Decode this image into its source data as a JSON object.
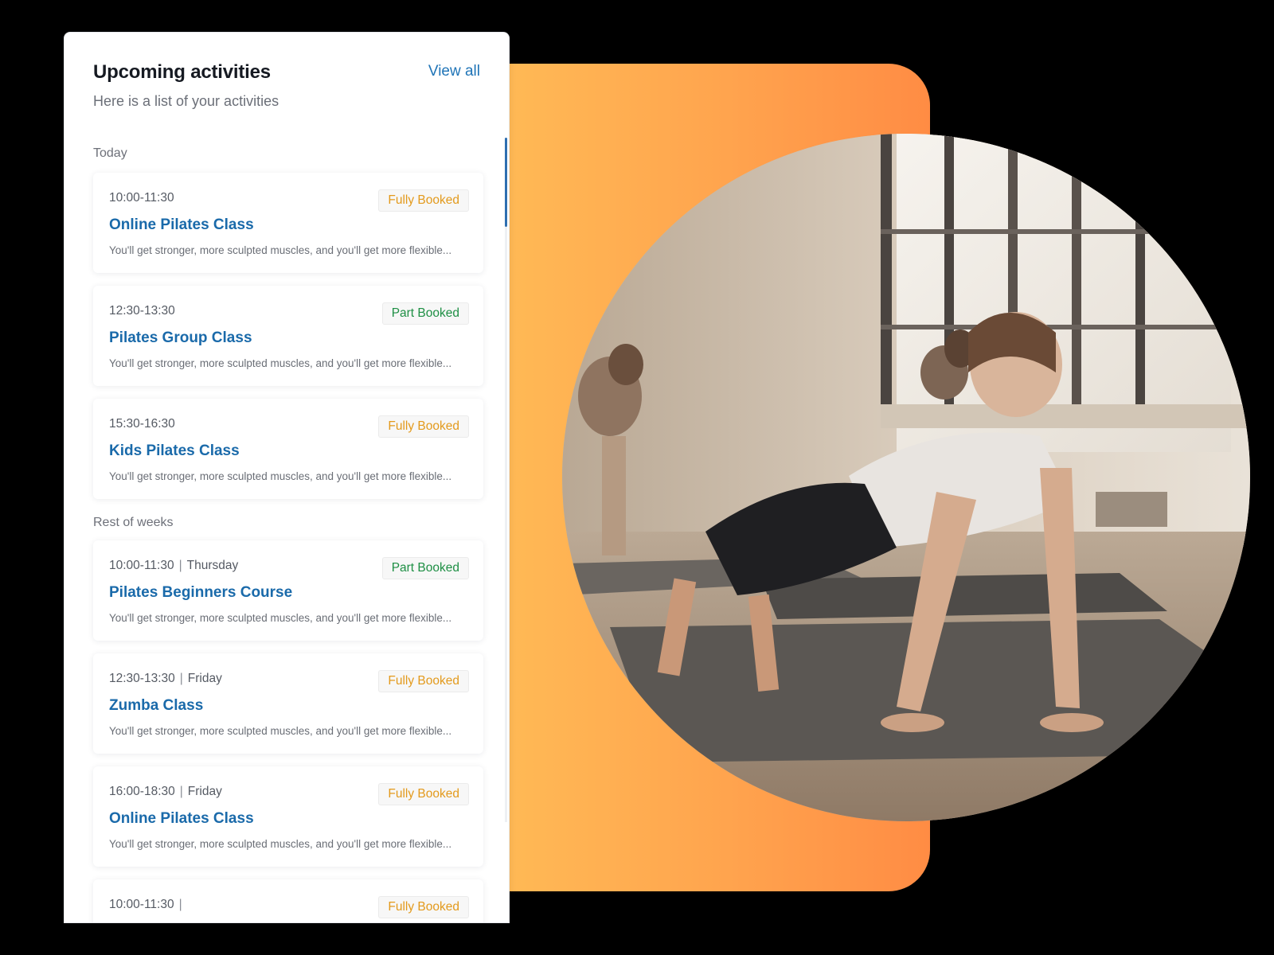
{
  "panel": {
    "title": "Upcoming activities",
    "subtitle": "Here is a list of your activities",
    "view_all": "View all"
  },
  "sections": {
    "today": "Today",
    "rest": "Rest of weeks"
  },
  "today_activities": [
    {
      "time": "10:00-11:30",
      "title": "Online Pilates Class",
      "status": "Fully Booked",
      "description": "You'll get stronger, more sculpted muscles, and you'll get more flexible..."
    },
    {
      "time": "12:30-13:30",
      "title": "Pilates Group Class",
      "status": "Part Booked",
      "description": "You'll get stronger, more sculpted muscles, and you'll get more flexible..."
    },
    {
      "time": "15:30-16:30",
      "title": "Kids Pilates Class",
      "status": "Fully Booked",
      "description": "You'll get stronger, more sculpted muscles, and you'll get more flexible..."
    }
  ],
  "week_activities": [
    {
      "time": "10:00-11:30",
      "day": "Thursday",
      "title": "Pilates Beginners Course",
      "status": "Part Booked",
      "description": "You'll get stronger, more sculpted muscles, and you'll get more flexible..."
    },
    {
      "time": "12:30-13:30",
      "day": "Friday",
      "title": "Zumba Class",
      "status": "Fully Booked",
      "description": "You'll get stronger, more sculpted muscles, and you'll get more flexible..."
    },
    {
      "time": "16:00-18:30",
      "day": "Friday",
      "title": "Online Pilates Class",
      "status": "Fully Booked",
      "description": "You'll get stronger, more sculpted muscles, and you'll get more flexible..."
    },
    {
      "time": "10:00-11:30",
      "day": "",
      "title": "",
      "status": "Fully Booked",
      "description": ""
    }
  ],
  "separator": "|",
  "colors": {
    "accent": "#1a6aaa",
    "fully_booked": "#e39a1c",
    "part_booked": "#1e8f44",
    "orange_start": "#ffbc56",
    "orange_end": "#ff8c44"
  }
}
